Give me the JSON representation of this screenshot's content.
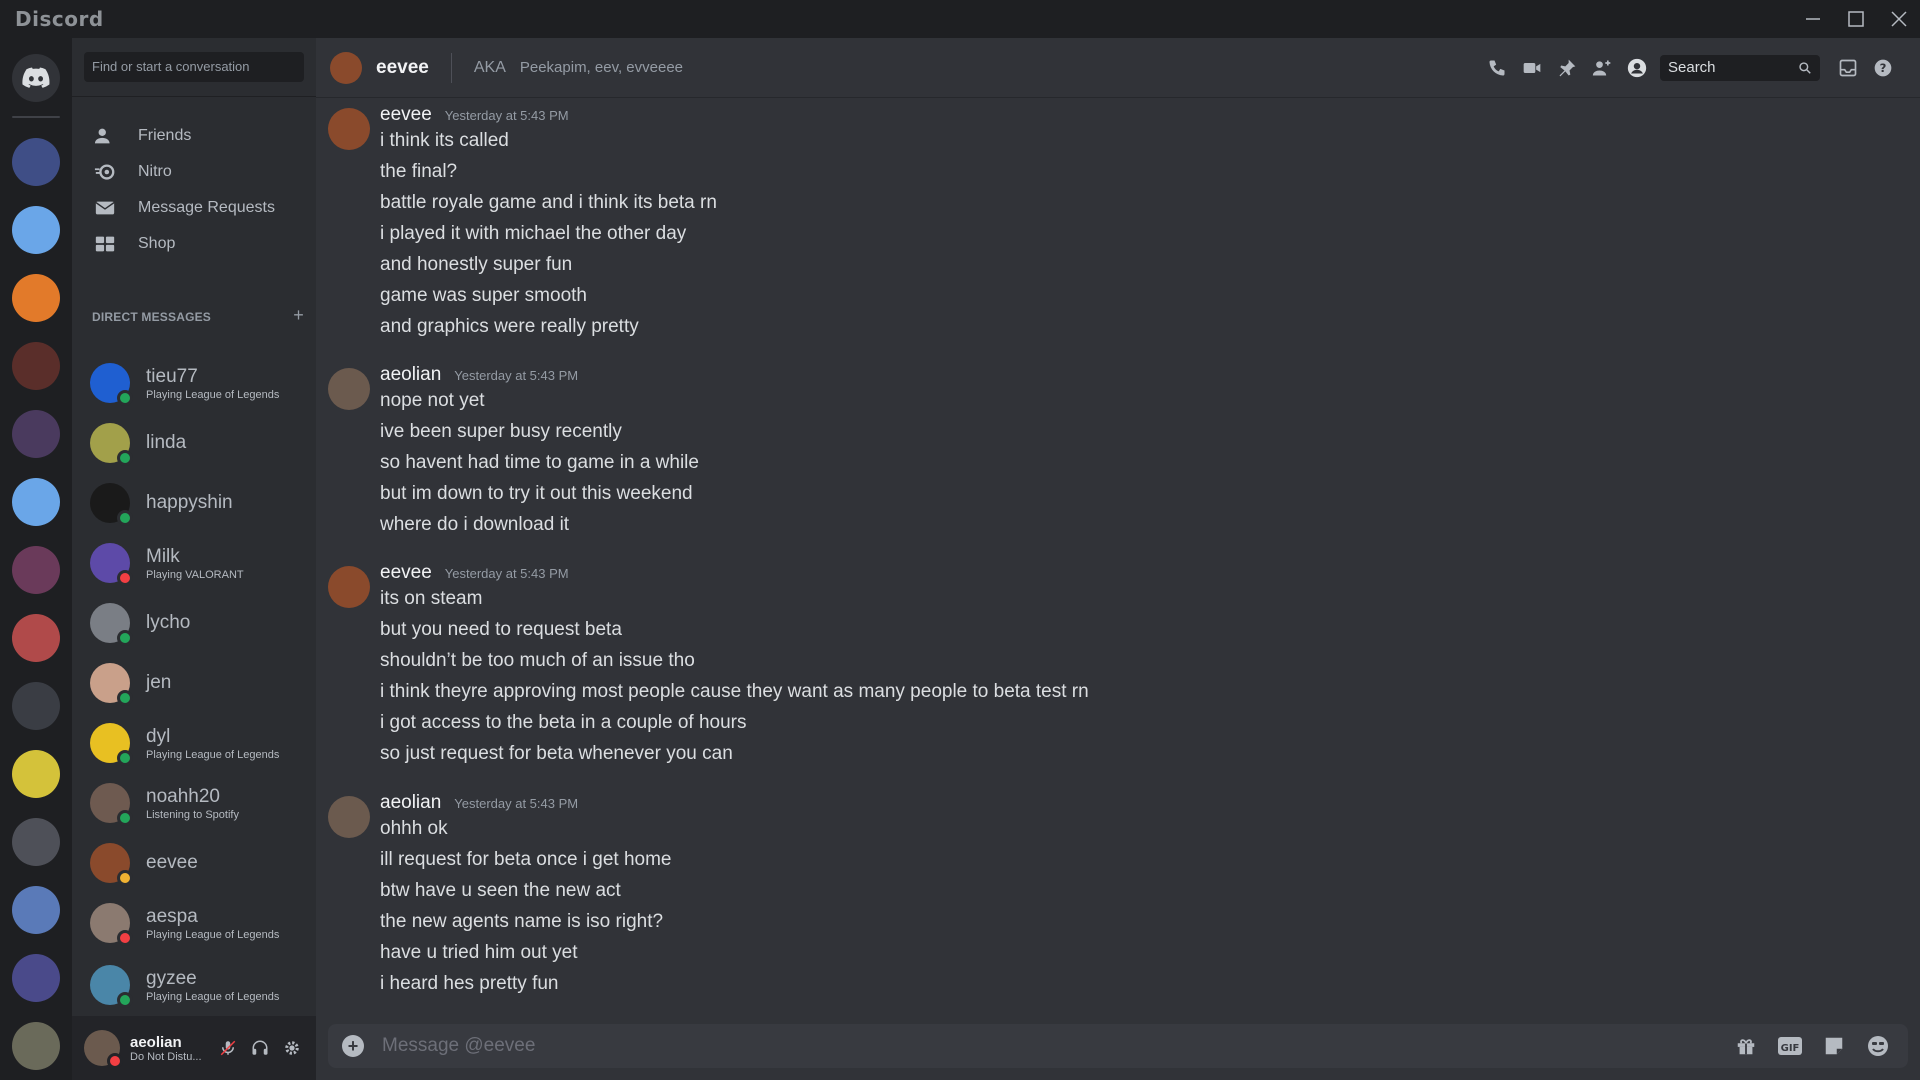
{
  "window": {
    "brand": "Discord",
    "controls": [
      "minimize",
      "maximize",
      "close"
    ]
  },
  "sidebar": {
    "search_placeholder": "Find or start a conversation",
    "nav": [
      {
        "label": "Friends",
        "icon": "friends-icon"
      },
      {
        "label": "Nitro",
        "icon": "nitro-icon"
      },
      {
        "label": "Message Requests",
        "icon": "envelope-icon"
      },
      {
        "label": "Shop",
        "icon": "shop-icon"
      }
    ],
    "dm_header": "DIRECT MESSAGES",
    "dms": [
      {
        "name": "tieu77",
        "activity": "Playing League of Legends",
        "status": "online",
        "color": "#1f5fd1"
      },
      {
        "name": "linda",
        "activity": "",
        "status": "online",
        "color": "#a2a04a"
      },
      {
        "name": "happyshin",
        "activity": "",
        "status": "online",
        "color": "#1a1a1a"
      },
      {
        "name": "Milk",
        "activity": "Playing VALORANT",
        "status": "dnd",
        "color": "#5d4aa8"
      },
      {
        "name": "lycho",
        "activity": "",
        "status": "online",
        "color": "#7a7e85"
      },
      {
        "name": "jen",
        "activity": "",
        "status": "online",
        "color": "#c9a08a"
      },
      {
        "name": "dyl",
        "activity": "Playing League of Legends",
        "status": "online",
        "color": "#e8c022"
      },
      {
        "name": "noahh20",
        "activity": "Listening to Spotify",
        "status": "online",
        "color": "#6e5a50"
      },
      {
        "name": "eevee",
        "activity": "",
        "status": "idle",
        "color": "#8a4a2c"
      },
      {
        "name": "aespa",
        "activity": "Playing League of Legends",
        "status": "dnd",
        "color": "#8b7a70"
      },
      {
        "name": "gyzee",
        "activity": "Playing League of Legends",
        "status": "online",
        "color": "#4a86a8"
      }
    ],
    "user": {
      "name": "aeolian",
      "status_text": "Do Not Distu..."
    }
  },
  "header": {
    "name": "eevee",
    "aka_label": "AKA",
    "aka_names": "Peekapim, eev, evveeee",
    "search_label": "Search"
  },
  "messages": [
    {
      "author": "eevee",
      "time": "Yesterday at 5:43 PM",
      "lines": [
        "i think its called",
        "the final?",
        "battle royale game and i think its beta rn",
        "i played it with michael the other day",
        "and honestly super fun",
        "game was super smooth",
        "and graphics were really pretty"
      ]
    },
    {
      "author": "aeolian",
      "time": "Yesterday at 5:43 PM",
      "lines": [
        "nope not yet",
        "ive been super busy recently",
        "so havent had time to game in a while",
        "but im down to try it out this weekend",
        "where do i download it"
      ]
    },
    {
      "author": "eevee",
      "time": "Yesterday at 5:43 PM",
      "lines": [
        "its on steam",
        "but you need to request beta",
        "shouldn’t be too much of an issue tho",
        "i think theyre approving most people cause they want as many people to beta test rn",
        "i got access to the beta in a couple of hours",
        "so just request for beta whenever you can"
      ]
    },
    {
      "author": "aeolian",
      "time": "Yesterday at 5:43 PM",
      "lines": [
        "ohhh ok",
        "ill request for beta once i get home",
        "btw have u seen the new act",
        "the new agents name is iso right?",
        "have u tried him out yet",
        "i heard hes pretty fun"
      ]
    }
  ],
  "composer": {
    "placeholder": "Message @eevee",
    "gif_label": "GIF"
  },
  "colors": {
    "online": "#23a55a",
    "dnd": "#f23f43",
    "idle": "#f0b232"
  }
}
